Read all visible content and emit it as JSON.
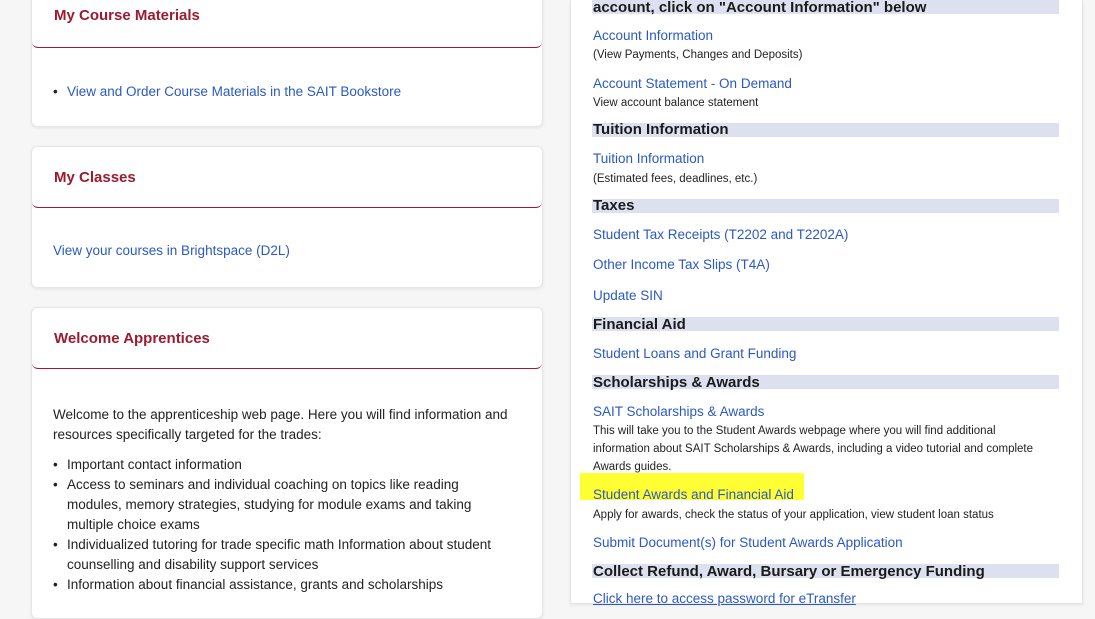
{
  "left": {
    "materials": {
      "title": "My Course Materials",
      "items": [
        "View and Order Course Materials in the SAIT Bookstore"
      ]
    },
    "classes": {
      "title": "My Classes",
      "link": "View your courses in Brightspace (D2L)"
    },
    "apprentices": {
      "title": "Welcome Apprentices",
      "intro": "Welcome to the apprenticeship web page. Here you will find information and resources specifically targeted for the trades:",
      "items": [
        "Important contact information",
        "Access to seminars and individual coaching on topics like reading modules, memory strategies, studying for module exams and taking multiple choice exams",
        "Individualized tutoring for trade specific math Information about student counselling and disability support services",
        "Information about financial assistance, grants and scholarships"
      ]
    }
  },
  "right": {
    "top_heading": "account, click on \"Account Information\" below",
    "account_info": {
      "link": "Account Information",
      "desc": "(View Payments, Changes and Deposits)"
    },
    "account_statement": {
      "link": "Account Statement - On Demand",
      "desc": "View account balance statement"
    },
    "tuition": {
      "heading": "Tuition Information",
      "link": "Tuition Information",
      "desc": "(Estimated fees, deadlines, etc.)"
    },
    "taxes": {
      "heading": "Taxes",
      "links": [
        "Student Tax Receipts (T2202 and T2202A)",
        "Other Income Tax Slips (T4A)",
        "Update SIN"
      ]
    },
    "financial_aid": {
      "heading": "Financial Aid",
      "link": "Student Loans and Grant Funding"
    },
    "scholarships": {
      "heading": "Scholarships & Awards",
      "link": "SAIT Scholarships & Awards",
      "desc": "This will take you to the Student Awards webpage where you will find additional information about SAIT Scholarships & Awards, including a video tutorial and complete Awards guides.",
      "awards_link": "Student Awards and Financial Aid",
      "awards_desc": "Apply for awards, check the status of your application, view student loan status",
      "submit_link": "Submit Document(s) for Student Awards Application"
    },
    "refund": {
      "heading": "Collect Refund, Award, Bursary or Emergency Funding",
      "link": "Click here to access password for eTransfer"
    }
  },
  "colors": {
    "accent": "#9b1b30",
    "link": "#2b59c3",
    "section_band": "#dde1ef",
    "highlight": "#ffff33"
  }
}
